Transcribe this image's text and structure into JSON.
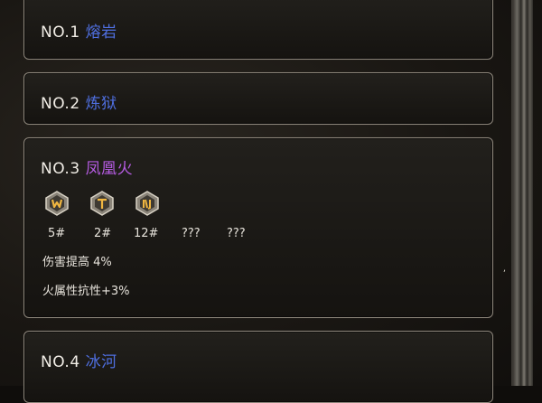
{
  "items": [
    {
      "num": "NO.1",
      "name": "熔岩",
      "name_color": "#4f6fe0"
    },
    {
      "num": "NO.2",
      "name": "炼狱",
      "name_color": "#4f6fe0"
    },
    {
      "num": "NO.3",
      "name": "凤凰火",
      "name_color": "#b45be0",
      "gems": [
        {
          "icon": "gem-rune-w-icon",
          "label": "5#"
        },
        {
          "icon": "gem-rune-t-icon",
          "label": "2#"
        },
        {
          "icon": "gem-rune-u-icon",
          "label": "12#"
        },
        {
          "icon": "",
          "label": "???"
        },
        {
          "icon": "",
          "label": "???"
        }
      ],
      "stats": [
        "伤害提高 4%",
        "火属性抗性+3%"
      ]
    },
    {
      "num": "NO.4",
      "name": "冰河",
      "name_color": "#4f6fe0"
    }
  ],
  "scroll_mark": ","
}
